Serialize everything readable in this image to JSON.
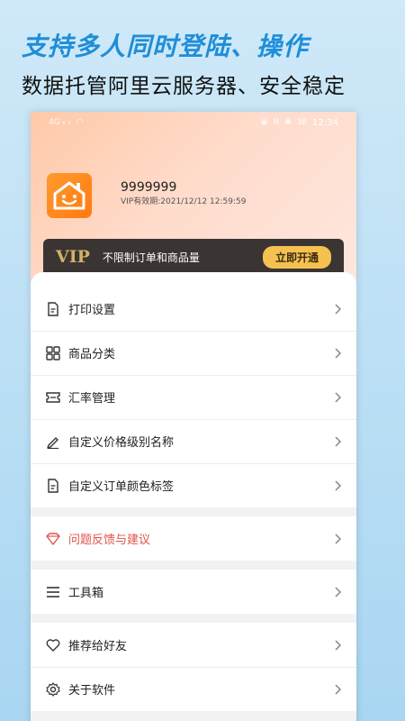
{
  "promo": {
    "title": "支持多人同时登陆、操作",
    "subtitle": "数据托管阿里云服务器、安全稳定"
  },
  "status_bar": {
    "left": "4G ᵢₗ ᵢₗ",
    "time": "12:34",
    "battery": "38"
  },
  "profile": {
    "username": "9999999",
    "vip_expiry": "VIP有效期:2021/12/12 12:59:59"
  },
  "vip_banner": {
    "logo": "VIP",
    "description": "不限制订单和商品量",
    "button_label": "立即开通"
  },
  "menu": {
    "group1": [
      {
        "label": "打印设置",
        "icon": "document-icon"
      },
      {
        "label": "商品分类",
        "icon": "grid-icon"
      },
      {
        "label": "汇率管理",
        "icon": "ticket-icon"
      },
      {
        "label": "自定义价格级别名称",
        "icon": "pencil-icon"
      },
      {
        "label": "自定义订单颜色标签",
        "icon": "document-icon"
      }
    ],
    "group2": [
      {
        "label": "问题反馈与建议",
        "icon": "diamond-icon"
      }
    ],
    "group3": [
      {
        "label": "工具箱",
        "icon": "hamburger-icon"
      }
    ],
    "group4": [
      {
        "label": "推荐给好友",
        "icon": "heart-icon"
      },
      {
        "label": "关于软件",
        "icon": "gear-icon"
      }
    ]
  },
  "colors": {
    "accent": "#1f8ed8",
    "vip_gold": "#f5c150",
    "feedback_red": "#e0524a"
  }
}
